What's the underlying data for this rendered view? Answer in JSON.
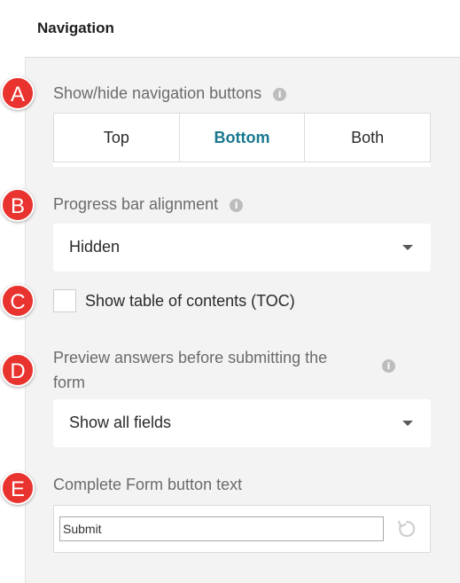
{
  "header": {
    "title": "Navigation"
  },
  "sections": {
    "nav_buttons": {
      "marker": "A",
      "label": "Show/hide navigation buttons",
      "options": [
        "Top",
        "Bottom",
        "Both"
      ],
      "selected": "Bottom"
    },
    "progress_bar": {
      "marker": "B",
      "label": "Progress bar alignment",
      "value": "Hidden"
    },
    "toc": {
      "marker": "C",
      "label": "Show table of contents (TOC)",
      "checked": false
    },
    "preview": {
      "marker": "D",
      "label_line1": "Preview answers before submitting the",
      "label_line2": "form",
      "value": "Show all fields"
    },
    "complete_button": {
      "marker": "E",
      "label": "Complete Form button text",
      "value": "Submit"
    }
  },
  "info_glyph": "i",
  "colors": {
    "marker": "#e8332f",
    "active_segment": "#19788f",
    "panel_bg": "#f3f3f3"
  }
}
